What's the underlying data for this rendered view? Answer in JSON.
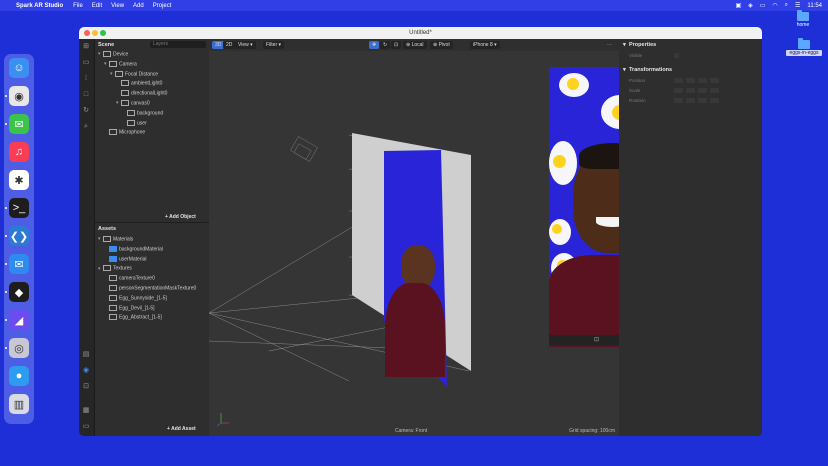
{
  "menubar": {
    "app_name": "Spark AR Studio",
    "menus": [
      "File",
      "Edit",
      "View",
      "Add",
      "Project"
    ],
    "clock": "11:54"
  },
  "desktop": {
    "icons": [
      {
        "label": "home",
        "icon": "folder-icon"
      },
      {
        "label": "eggs-in-eggs",
        "icon": "folder-icon"
      }
    ]
  },
  "dock": {
    "apps": [
      {
        "name": "finder",
        "color": "#3a8ff0",
        "glyph": "☺"
      },
      {
        "name": "chrome",
        "color": "#e8e8e8",
        "glyph": "◉"
      },
      {
        "name": "messages",
        "color": "#3bc34c",
        "glyph": "✉"
      },
      {
        "name": "music",
        "color": "#fa3c55",
        "glyph": "♫"
      },
      {
        "name": "slack",
        "color": "#ffffff",
        "glyph": "✱"
      },
      {
        "name": "terminal",
        "color": "#1d1d1d",
        "glyph": ">_"
      },
      {
        "name": "vscode",
        "color": "#2a7ad6",
        "glyph": "❮❯"
      },
      {
        "name": "mail",
        "color": "#2f8af0",
        "glyph": "✉"
      },
      {
        "name": "figma",
        "color": "#1d1d1d",
        "glyph": "◆"
      },
      {
        "name": "spark-ar",
        "color": "#6c4bf0",
        "glyph": "◢"
      },
      {
        "name": "disk-utility",
        "color": "#c8c8d4",
        "glyph": "◎"
      },
      {
        "name": "twitterrific",
        "color": "#2d9cf0",
        "glyph": "●"
      },
      {
        "name": "trash",
        "color": "#d8dbe6",
        "glyph": "▥"
      }
    ]
  },
  "window": {
    "title": "Untitled*"
  },
  "scene_panel": {
    "header": "Scene",
    "search_placeholder": "Layers",
    "tree": [
      {
        "label": "Device",
        "depth": 0,
        "arrow": "▾",
        "icon": "device-icon"
      },
      {
        "label": "Camera",
        "depth": 1,
        "arrow": "▾",
        "icon": "camera-icon"
      },
      {
        "label": "Focal Distance",
        "depth": 2,
        "arrow": "▾",
        "icon": "focal-icon"
      },
      {
        "label": "ambientLight0",
        "depth": 3,
        "arrow": "",
        "icon": "light-icon"
      },
      {
        "label": "directionalLight0",
        "depth": 3,
        "arrow": "",
        "icon": "light-icon"
      },
      {
        "label": "canvas0",
        "depth": 3,
        "arrow": "▾",
        "icon": "canvas-icon"
      },
      {
        "label": "background",
        "depth": 4,
        "arrow": "",
        "icon": "rect-icon"
      },
      {
        "label": "user",
        "depth": 4,
        "arrow": "",
        "icon": "rect-icon"
      },
      {
        "label": "Microphone",
        "depth": 1,
        "arrow": "",
        "icon": "microphone-icon"
      }
    ],
    "add_label": "+ Add Object"
  },
  "assets_panel": {
    "header": "Assets",
    "tree": [
      {
        "label": "Materials",
        "depth": 0,
        "arrow": "▾",
        "icon": "folder-icon"
      },
      {
        "label": "backgroundMaterial",
        "depth": 1,
        "arrow": "",
        "icon": "material-icon"
      },
      {
        "label": "userMaterial",
        "depth": 1,
        "arrow": "",
        "icon": "material-icon"
      },
      {
        "label": "Textures",
        "depth": 0,
        "arrow": "▾",
        "icon": "folder-icon"
      },
      {
        "label": "cameraTexture0",
        "depth": 1,
        "arrow": "",
        "icon": "texture-icon"
      },
      {
        "label": "personSegmentationMaskTexture0",
        "depth": 1,
        "arrow": "",
        "icon": "texture-icon"
      },
      {
        "label": "Egg_Sunnyside_[1-5]",
        "depth": 1,
        "arrow": "",
        "icon": "texture-icon"
      },
      {
        "label": "Egg_Devil_[1-5]",
        "depth": 1,
        "arrow": "",
        "icon": "texture-icon"
      },
      {
        "label": "Egg_Abstract_[1-5]",
        "depth": 1,
        "arrow": "",
        "icon": "texture-icon"
      }
    ],
    "add_label": "+ Add Asset"
  },
  "viewport": {
    "view_label": "View",
    "filter_label": "Filter",
    "local_label": "Local",
    "pivot_label": "Pivot",
    "device_label": "iPhone 8",
    "footer_center": "Camera: Front",
    "footer_right": "Grid spacing: 100cm"
  },
  "properties_panel": {
    "header": "Properties",
    "visible_label": "Visible",
    "transformations_header": "Transformations",
    "rows": [
      "Position",
      "Scale",
      "Rotation"
    ]
  },
  "colors": {
    "desktop": "#1e2fd8",
    "egg_background": "#2a24d8",
    "accent": "#2f7ee8"
  }
}
